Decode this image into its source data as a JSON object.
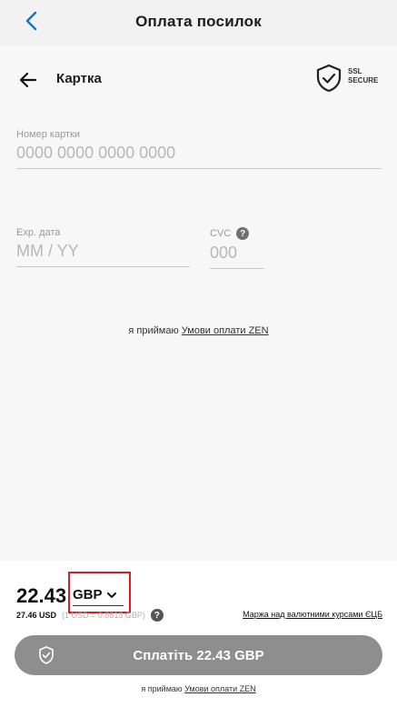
{
  "header": {
    "title": "Оплата посилок",
    "back_icon": "chevron-left-icon"
  },
  "card_section": {
    "title": "Картка",
    "ssl_line1": "SSL",
    "ssl_line2": "SECURE"
  },
  "form": {
    "card_number_label": "Номер картки",
    "card_number_placeholder": "0000 0000 0000 0000",
    "expiry_label": "Exp. дата",
    "expiry_placeholder": "MM / YY",
    "cvc_label": "CVC",
    "cvc_placeholder": "000",
    "help_symbol": "?"
  },
  "terms": {
    "prefix": "я приймаю",
    "link": "Умови оплати ZEN"
  },
  "summary": {
    "amount": "22.43",
    "currency": "GBP",
    "usd_amount": "27.46 USD",
    "rate_text": "(1 USD = 0.8",
    "rate_suffix": "813 GBP)",
    "margin_link": "Маржа над валютними курсами ЄЦБ"
  },
  "pay_button": {
    "label": "Сплатіть 22.43 GBP"
  },
  "bottom_terms": {
    "prefix": "я приймаю",
    "link": "Умови оплати ZEN"
  },
  "colors": {
    "accent": "#1a73c9",
    "pay_button_bg": "#8e8e8e",
    "highlight": "#e5161e"
  }
}
